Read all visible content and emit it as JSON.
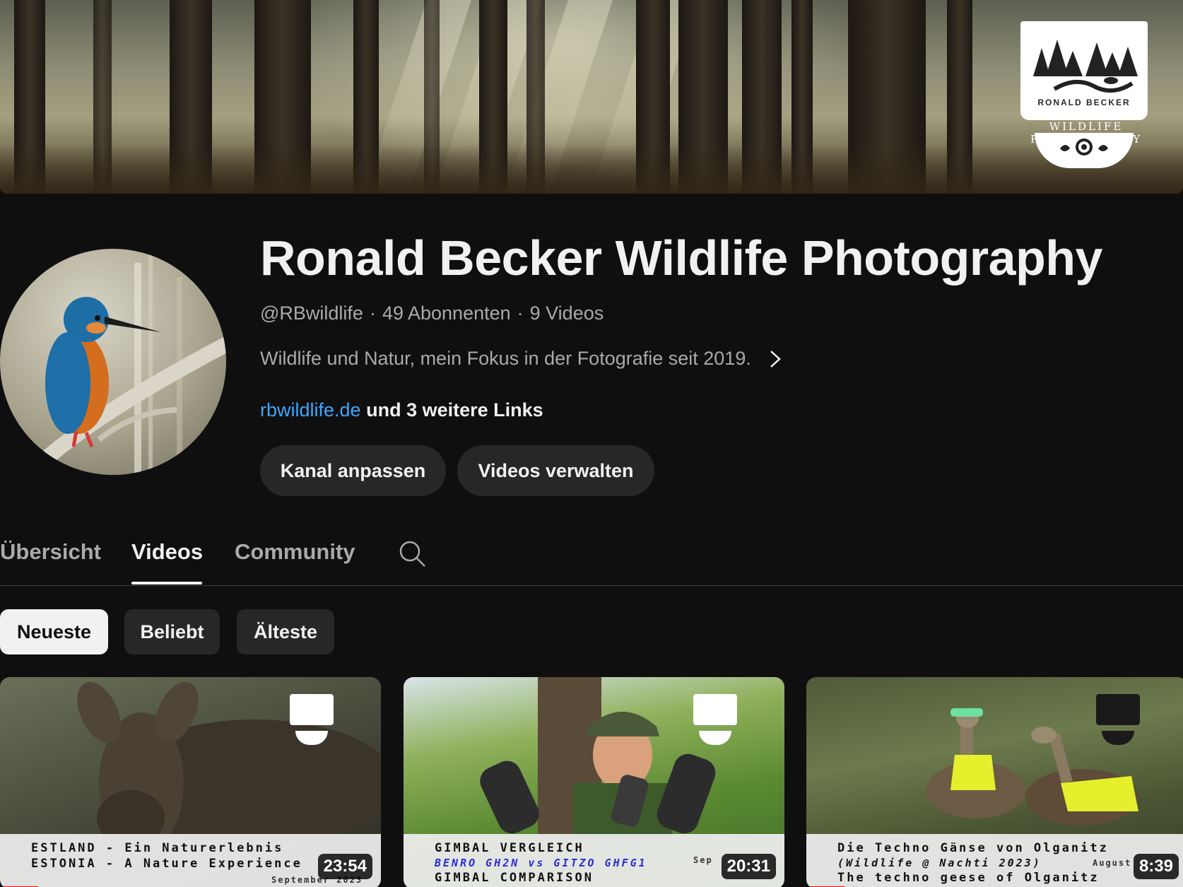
{
  "channel": {
    "name": "Ronald Becker Wildlife Photography",
    "handle": "@RBwildlife",
    "subscribers": "49 Abonnenten",
    "video_count": "9 Videos",
    "separator": "·",
    "description": "Wildlife und Natur, mein Fokus in der Fotografie seit 2019.",
    "link": "rbwildlife.de",
    "more_links": "und 3 weitere Links",
    "banner_logo": {
      "name": "RONALD BECKER",
      "tagline": "WILDLIFE PHOTOGRAPHY"
    }
  },
  "actions": {
    "customize": "Kanal anpassen",
    "manage": "Videos verwalten"
  },
  "tabs": [
    {
      "label": "Übersicht",
      "active": false
    },
    {
      "label": "Videos",
      "active": true
    },
    {
      "label": "Community",
      "active": false
    }
  ],
  "filters": [
    {
      "label": "Neueste",
      "selected": true
    },
    {
      "label": "Beliebt",
      "selected": false
    },
    {
      "label": "Älteste",
      "selected": false
    }
  ],
  "videos": [
    {
      "caption_line1": "ESTLAND - Ein Naturerlebnis",
      "caption_line2": "ESTONIA - A Nature Experience",
      "caption_date": "September 2023",
      "duration": "23:54",
      "progress": 0.1
    },
    {
      "caption_line1": "GIMBAL VERGLEICH",
      "caption_line2": "BENRO GH2N vs GITZO GHFG1",
      "caption_line3": "GIMBAL COMPARISON",
      "caption_date": "Sep",
      "duration": "20:31",
      "progress": 0
    },
    {
      "caption_line1": "Die Techno Gänse von Olganitz",
      "caption_line2": "(Wildlife @ Nachti 2023)",
      "caption_line3": "The techno geese of Olganitz",
      "caption_date": "August",
      "duration": "8:39",
      "progress": 0.1
    }
  ],
  "colors": {
    "background": "#0f0f0f",
    "link": "#3ea6ff",
    "chip": "#272727",
    "progress": "#ff0000"
  }
}
